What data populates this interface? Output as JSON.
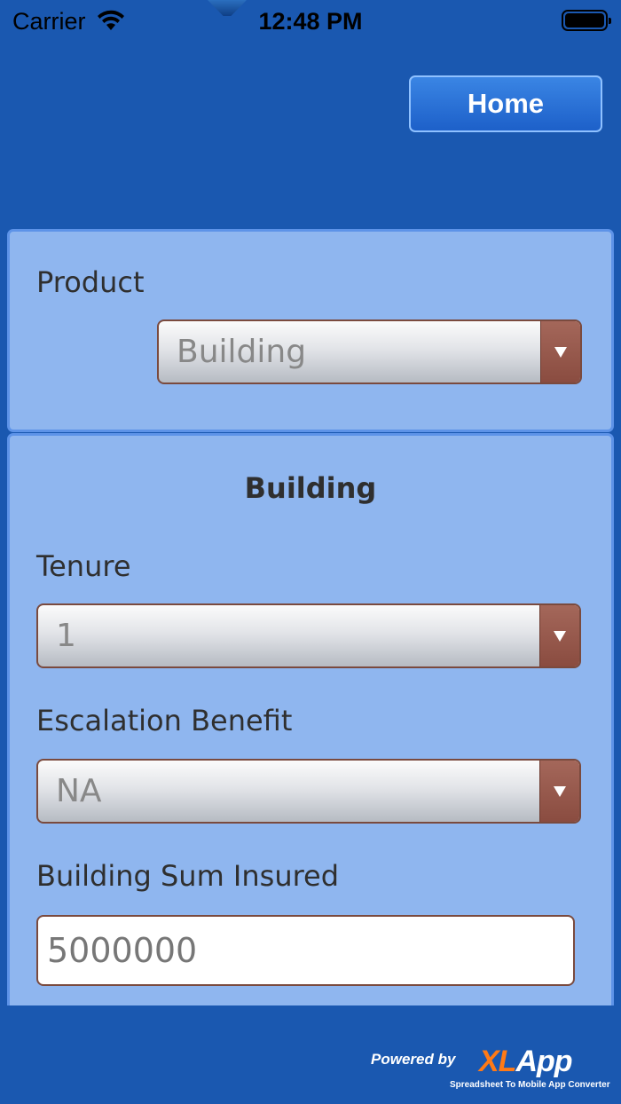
{
  "status_bar": {
    "carrier": "Carrier",
    "time": "12:48 PM"
  },
  "header": {
    "home_label": "Home"
  },
  "product": {
    "label": "Product",
    "selected": "Building"
  },
  "building": {
    "title": "Building",
    "tenure_label": "Tenure",
    "tenure_value": "1",
    "escalation_label": "Escalation Benefit",
    "escalation_value": "NA",
    "sum_insured_label": "Building Sum Insured",
    "sum_insured_value": "5000000"
  },
  "footer": {
    "powered_by": "Powered by",
    "logo_xl": "XL",
    "logo_app": "App",
    "tagline": "Spreadsheet To Mobile App Converter"
  },
  "colors": {
    "background": "#1a58b0",
    "panel": "#8fb6ef",
    "dropdown_arrow": "#8a4c40",
    "logo_accent": "#ff7a16"
  }
}
